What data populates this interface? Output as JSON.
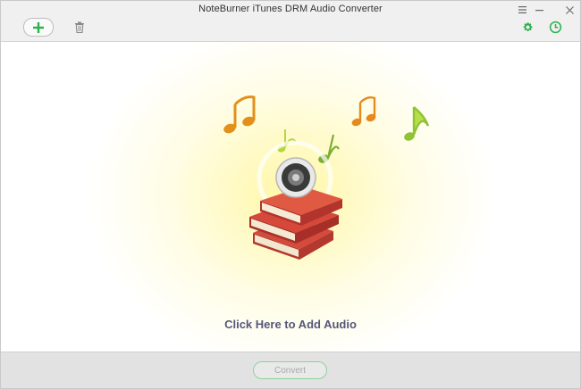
{
  "window": {
    "title": "NoteBurner iTunes DRM Audio Converter"
  },
  "toolbar": {
    "add_icon": "plus-icon",
    "delete_icon": "trash-icon",
    "settings_icon": "gear-icon",
    "history_icon": "clock-icon"
  },
  "window_controls": [
    "menu-icon",
    "minimize-icon",
    "close-icon"
  ],
  "main": {
    "prompt": "Click Here to Add Audio",
    "illustration": "books-speaker-music-notes"
  },
  "footer": {
    "convert_label": "Convert",
    "convert_enabled": false
  },
  "colors": {
    "accent_green": "#2bb24c",
    "prompt_text": "#54577a",
    "glow": "#fff7a6"
  }
}
